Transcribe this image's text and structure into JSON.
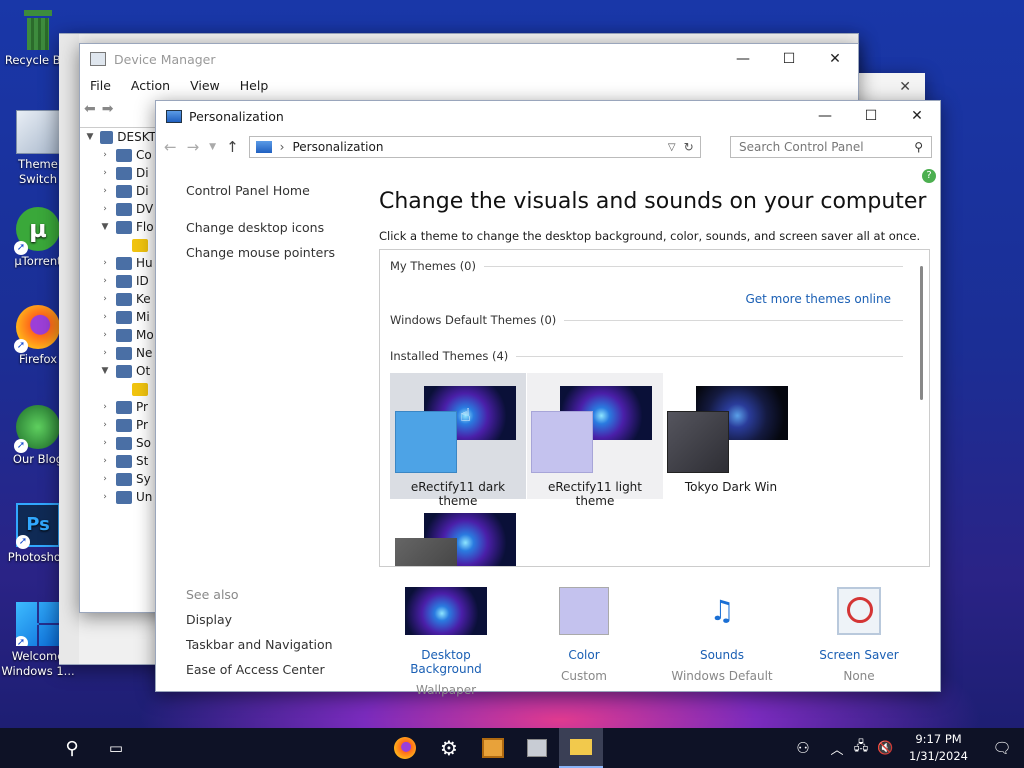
{
  "desktop": {
    "icons": [
      {
        "label": "Recycle Bin",
        "icon": "recycle-bin-icon"
      },
      {
        "label": "Theme Switch",
        "icon": "folder-icon"
      },
      {
        "label": "µTorrent",
        "icon": "utorrent-icon"
      },
      {
        "label": "Firefox",
        "icon": "firefox-icon"
      },
      {
        "label": "Our Blog",
        "icon": "blog-icon"
      },
      {
        "label": "Photoshop",
        "icon": "photoshop-icon"
      },
      {
        "label": "Welcome Windows 1...",
        "icon": "windows-icon"
      }
    ]
  },
  "device_manager": {
    "title": "Device Manager",
    "menu": [
      "File",
      "Action",
      "View",
      "Help"
    ],
    "tree_root": "DESKT",
    "tree_items": [
      "Co",
      "Di",
      "Di",
      "DV",
      "Flo",
      "",
      "Hu",
      "ID",
      "Ke",
      "Mi",
      "Mo",
      "Ne",
      "Ot",
      "",
      "Pr",
      "Pr",
      "So",
      "St",
      "Sy",
      "Un"
    ]
  },
  "personalization": {
    "title": "Personalization",
    "address": "Personalization",
    "search_placeholder": "Search Control Panel",
    "left": {
      "home": "Control Panel Home",
      "links": [
        "Change desktop icons",
        "Change mouse pointers"
      ],
      "see_also": "See also",
      "see_also_links": [
        "Display",
        "Taskbar and Navigation",
        "Ease of Access Center"
      ]
    },
    "heading": "Change the visuals and sounds on your computer",
    "subheading": "Click a theme to change the desktop background, color, sounds, and screen saver all at once.",
    "my_themes": "My Themes (0)",
    "get_more": "Get more themes online",
    "default_themes": "Windows Default Themes (0)",
    "installed_themes": "Installed Themes (4)",
    "themes": [
      {
        "name": "eRectify11 dark theme",
        "swatch": "#4da3e6",
        "selected": true
      },
      {
        "name": "eRectify11 light theme",
        "swatch": "#c4c2ee",
        "selected": false
      },
      {
        "name": "Tokyo Dark Win",
        "swatch": "#4a4a52",
        "selected": false
      }
    ],
    "bottom": [
      {
        "label": "Desktop Background",
        "value": "Wallpaper"
      },
      {
        "label": "Color",
        "value": "Custom"
      },
      {
        "label": "Sounds",
        "value": "Windows Default"
      },
      {
        "label": "Screen Saver",
        "value": "None"
      }
    ]
  },
  "taskbar": {
    "time": "9:17 PM",
    "date": "1/31/2024"
  }
}
